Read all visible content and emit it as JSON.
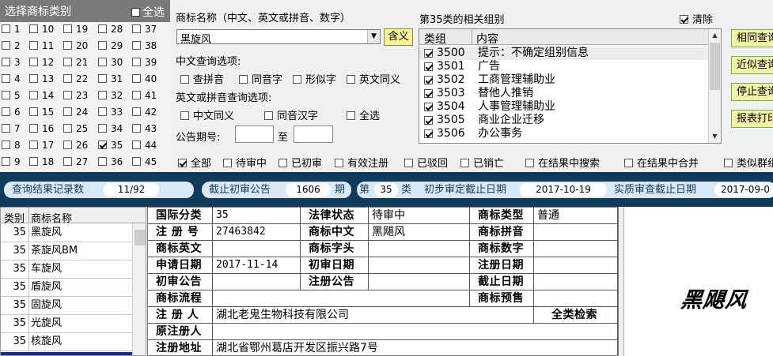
{
  "class_panel": {
    "title": "选择商标类别",
    "select_all": "全选",
    "columns": [
      [
        {
          "n": "1",
          "c": false
        },
        {
          "n": "2",
          "c": false
        },
        {
          "n": "3",
          "c": false
        },
        {
          "n": "4",
          "c": false
        },
        {
          "n": "5",
          "c": false
        },
        {
          "n": "6",
          "c": false
        },
        {
          "n": "7",
          "c": false
        },
        {
          "n": "8",
          "c": false
        },
        {
          "n": "9",
          "c": false
        }
      ],
      [
        {
          "n": "10",
          "c": false
        },
        {
          "n": "11",
          "c": false
        },
        {
          "n": "12",
          "c": false
        },
        {
          "n": "13",
          "c": false
        },
        {
          "n": "14",
          "c": false
        },
        {
          "n": "15",
          "c": false
        },
        {
          "n": "16",
          "c": false
        },
        {
          "n": "17",
          "c": false
        },
        {
          "n": "18",
          "c": false
        }
      ],
      [
        {
          "n": "19",
          "c": false
        },
        {
          "n": "20",
          "c": false
        },
        {
          "n": "21",
          "c": false
        },
        {
          "n": "22",
          "c": false
        },
        {
          "n": "23",
          "c": false
        },
        {
          "n": "24",
          "c": false
        },
        {
          "n": "25",
          "c": false
        },
        {
          "n": "26",
          "c": false
        },
        {
          "n": "27",
          "c": false
        }
      ],
      [
        {
          "n": "28",
          "c": false
        },
        {
          "n": "29",
          "c": false
        },
        {
          "n": "30",
          "c": false
        },
        {
          "n": "31",
          "c": false
        },
        {
          "n": "32",
          "c": false
        },
        {
          "n": "33",
          "c": false
        },
        {
          "n": "34",
          "c": false
        },
        {
          "n": "35",
          "c": true
        },
        {
          "n": "36",
          "c": false
        }
      ],
      [
        {
          "n": "37",
          "c": false
        },
        {
          "n": "38",
          "c": false
        },
        {
          "n": "39",
          "c": false
        },
        {
          "n": "40",
          "c": false
        },
        {
          "n": "41",
          "c": false
        },
        {
          "n": "42",
          "c": false
        },
        {
          "n": "43",
          "c": false
        },
        {
          "n": "44",
          "c": false
        },
        {
          "n": "45",
          "c": false
        }
      ]
    ]
  },
  "search": {
    "name_label": "商标名称（中文、英文或拼音、数字）",
    "name_value": "黑旋风",
    "meaning_button": "含义",
    "cn_options_label": "中文查询选项:",
    "cn_options": [
      "查拼音",
      "同音字",
      "形似字",
      "英文同义"
    ],
    "en_options_label": "英文或拼音查询选项:",
    "en_options": [
      "中文同义",
      "同音汉字",
      "全选"
    ],
    "issue_label": "公告期号:",
    "issue_to": "至"
  },
  "groups": {
    "title": "第35类的相关组别",
    "clear_label": "清除",
    "col_group": "类组",
    "col_content": "内容",
    "rows": [
      {
        "code": "3500",
        "desc": "提示：不确定组别信息"
      },
      {
        "code": "3501",
        "desc": "广告"
      },
      {
        "code": "3502",
        "desc": "工商管理辅助业"
      },
      {
        "code": "3503",
        "desc": "替他人推销"
      },
      {
        "code": "3504",
        "desc": "人事管理辅助业"
      },
      {
        "code": "3505",
        "desc": "商业企业迁移"
      },
      {
        "code": "3506",
        "desc": "办公事务"
      }
    ]
  },
  "side_buttons": [
    "相同查询",
    "近似查询",
    "停止查询",
    "报表打印"
  ],
  "filters": [
    "全部",
    "待审中",
    "已初审",
    "有效注册",
    "已驳回",
    "已销亡",
    "在结果中搜索",
    "在结果中合并",
    "类似群组"
  ],
  "status_bar": {
    "count_label": "查询结果记录数",
    "count_value": "11/92",
    "deadline_label": "截止初审公告",
    "deadline_value": "1606",
    "deadline_unit": "期",
    "class_prefix": "第",
    "class_value": "35",
    "class_suffix": "类",
    "prelim_label": "初步审定截止日期",
    "prelim_value": "2017-10-19",
    "exam_label": "实质审查截止日期",
    "exam_value": "2017-09-0"
  },
  "results": {
    "col_class": "类别",
    "col_name": "商标名称",
    "rows": [
      {
        "cls": "35",
        "name": "黑旋风"
      },
      {
        "cls": "35",
        "name": "茶旋风BM"
      },
      {
        "cls": "35",
        "name": "车旋风"
      },
      {
        "cls": "35",
        "name": "盾旋风"
      },
      {
        "cls": "35",
        "name": "固旋风"
      },
      {
        "cls": "35",
        "name": "光旋风"
      },
      {
        "cls": "35",
        "name": "核旋风"
      }
    ]
  },
  "detail": {
    "intl_class_label": "国际分类",
    "intl_class_value": "35",
    "legal_status_label": "法律状态",
    "legal_status_value": "待审中",
    "tm_type_label": "商标类型",
    "tm_type_value": "普通",
    "reg_no_label": "注 册 号",
    "reg_no_value": "27463842",
    "tm_cn_label": "商标中文",
    "tm_cn_value": "黑飓风",
    "tm_pinyin_label": "商标拼音",
    "tm_en_label": "商标英文",
    "tm_prefix_label": "商标字头",
    "tm_digit_label": "商标数字",
    "apply_date_label": "申请日期",
    "apply_date_value": "2017-11-14",
    "prelim_date_label": "初审日期",
    "reg_date_label": "注册日期",
    "prelim_notice_label": "初审公告",
    "reg_notice_label": "注册公告",
    "expire_label": "截止日期",
    "process_label": "商标流程",
    "forecast_label": "商标预售",
    "registrant_label": "注 册 人",
    "registrant_value": "湖北老鬼生物科技有限公司",
    "all_class_label": "全类检索",
    "orig_registrant_label": "原注册人",
    "reg_addr_label": "注册地址",
    "reg_addr_value": "湖北省鄂州葛店开发区振兴路7号"
  },
  "image": {
    "text": "黑飓风"
  }
}
